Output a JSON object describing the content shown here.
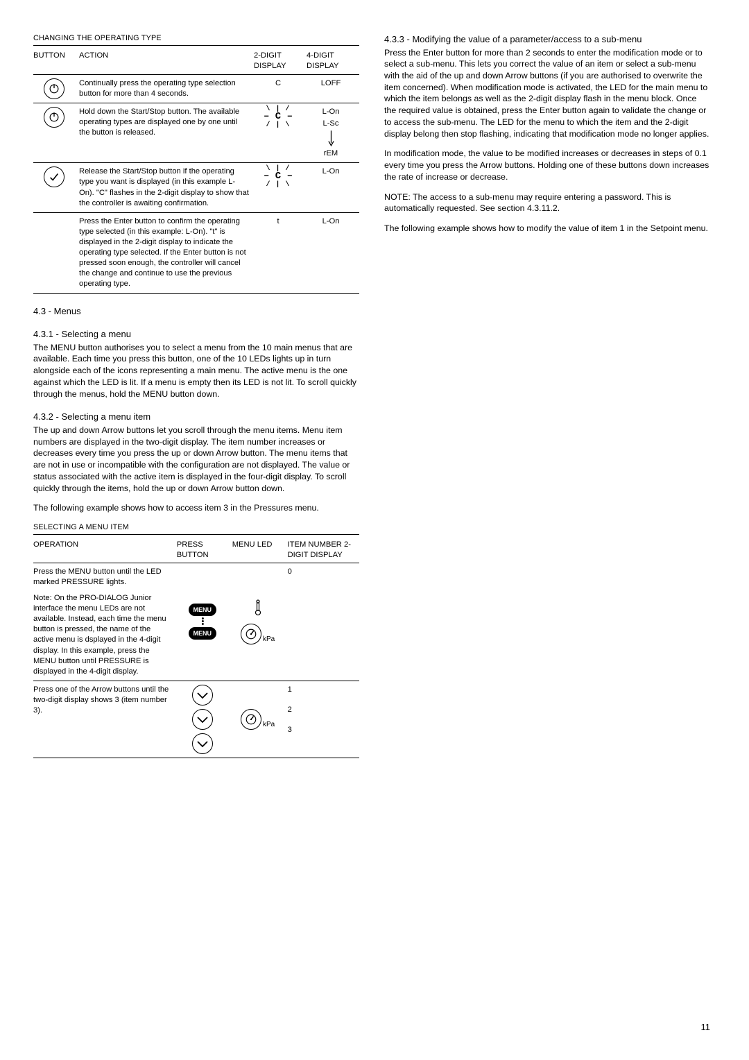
{
  "page_number": "11",
  "left": {
    "table1": {
      "title": "CHANGING THE OPERATING TYPE",
      "head": {
        "c1": "BUTTON",
        "c2": "ACTION",
        "c3": "2-DIGIT DISPLAY",
        "c4": "4-DIGIT DISPLAY"
      },
      "rows": [
        {
          "action": "Continually press the operating type selection button for more than 4 seconds.",
          "d2": "C",
          "d4": "LOFF"
        },
        {
          "action": "Hold down the Start/Stop button. The available operating types are displayed one by one until the button is released.",
          "d4a": "L-On",
          "d4b": "L-Sc",
          "d4c": "rEM"
        },
        {
          "action": "Release the Start/Stop button if the operating type you want is displayed (in this example L-On). \"C\" flashes in the 2-digit display to show that the controller is awaiting confirmation.",
          "d4": "L-On"
        },
        {
          "action": "Press the Enter button to confirm the operating type selected (in this example: L-On). \"t\" is displayed in the 2-digit display to indicate the operating type selected. If the Enter button is not pressed soon enough, the controller will cancel the change and continue to use the previous operating type.",
          "d2": "t",
          "d4": "L-On"
        }
      ]
    },
    "sec43": "4.3 - Menus",
    "sec431_h": "4.3.1 - Selecting a menu",
    "sec431_p": "The MENU button authorises you to select a menu from the 10 main menus that are available. Each time you press this button, one of the 10 LEDs lights up in turn alongside each of the icons representing a main menu. The active menu is the one against which the LED is lit. If a menu is empty then its LED is not lit. To scroll quickly through the menus, hold the MENU button down.",
    "sec432_h": "4.3.2 - Selecting a menu item",
    "sec432_p1": "The up and down Arrow buttons let you scroll through the menu items. Menu item numbers are displayed in the two-digit display. The item number increases or decreases every time you press the up or down Arrow button. The menu items that are not in use or incompatible with the configuration are not displayed. The value or status associated with the active item is displayed in the four-digit display. To scroll quickly through the items, hold the up or down Arrow button down.",
    "sec432_p2": "The following example shows how to access item 3 in the Pressures menu.",
    "table2": {
      "title": "SELECTING A MENU ITEM",
      "head": {
        "c1": "OPERATION",
        "c2": "PRESS BUTTON",
        "c3": "MENU LED",
        "c4": "ITEM NUMBER 2-DIGIT DISPLAY"
      },
      "row1": {
        "op_a": "Press the MENU button until the LED marked PRESSURE lights.",
        "op_b": "Note: On the PRO-DIALOG Junior interface the menu LEDs are not available. Instead, each time the menu button is pressed, the name of the active menu is dsplayed in the 4-digit display. In this example, press the MENU button until PRESSURE is displayed in the 4-digit display.",
        "menu_label": "MENU",
        "kpa": "kPa",
        "num": "0"
      },
      "row2": {
        "op": "Press one of the Arrow buttons until the two-digit display shows 3 (item number 3).",
        "kpa": "kPa",
        "n1": "1",
        "n2": "2",
        "n3": "3"
      }
    }
  },
  "right": {
    "sec433_h": "4.3.3 - Modifying the value of a parameter/access to a sub-menu",
    "sec433_p1": "Press the Enter button for more than 2 seconds to enter the modification mode or to select a sub-menu. This lets you correct the value of an item or select a sub-menu with the aid of the up and down Arrow buttons (if you are authorised to overwrite the item concerned). When modification mode is activated, the LED for the main menu to which the item belongs as well as the 2-digit display flash in the menu block. Once the required value is obtained, press the Enter button again to validate the change or to access the sub-menu. The LED for the menu to which the item and the 2-digit display belong then stop flashing, indicating that modification mode no longer applies.",
    "sec433_p2": "In modification mode, the value to be modified increases or decreases in steps of 0.1 every time you press the Arrow buttons. Holding one of these buttons down increases the rate of increase or decrease.",
    "sec433_p3": "NOTE: The access to a sub-menu may require entering a password. This is automatically requested. See section 4.3.11.2.",
    "sec433_p4": "The following example shows how to modify the value of item 1 in the Setpoint menu."
  }
}
